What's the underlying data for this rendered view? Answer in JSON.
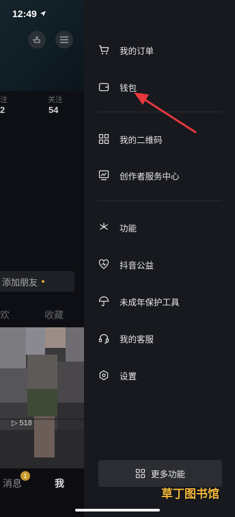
{
  "status_bar": {
    "time": "12:49"
  },
  "profile_background": {
    "stats": [
      {
        "label": "注",
        "value": "2"
      },
      {
        "label": "关注",
        "value": "54"
      }
    ],
    "add_friend_label": "添加朋友",
    "tabs": [
      "欢",
      "收藏"
    ],
    "play_count": "518",
    "bottom_nav": {
      "messages": "消息",
      "messages_badge": "1",
      "me": "我"
    }
  },
  "drawer": {
    "group1": [
      {
        "label": "我的订单",
        "icon": "cart-icon"
      },
      {
        "label": "钱包",
        "icon": "wallet-icon"
      }
    ],
    "group2": [
      {
        "label": "我的二维码",
        "icon": "qr-code-icon"
      },
      {
        "label": "创作者服务中心",
        "icon": "creator-center-icon"
      }
    ],
    "group3": [
      {
        "label": "功能",
        "icon": "asterisk-icon"
      },
      {
        "label": "抖音公益",
        "icon": "charity-heart-icon"
      },
      {
        "label": "未成年保护工具",
        "icon": "umbrella-icon"
      },
      {
        "label": "我的客服",
        "icon": "headset-icon"
      },
      {
        "label": "设置",
        "icon": "settings-hexagon-icon"
      }
    ],
    "more_button": "更多功能"
  },
  "annotation": {
    "arrow_color": "#e8383d"
  },
  "watermark": "草丁图书馆"
}
